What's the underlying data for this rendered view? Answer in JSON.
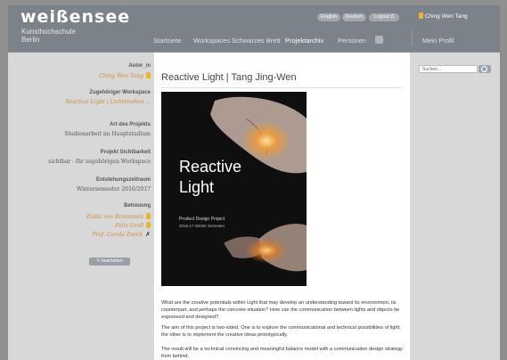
{
  "header": {
    "logo": "weißensee",
    "logo_sub1": "Kunsthochschule",
    "logo_sub2": "Berlin",
    "lang_en": "English",
    "lang_de": "Deutsch",
    "logout": "Logout",
    "user": "Ching Wen Tang"
  },
  "nav": {
    "items": [
      "Startseite",
      "Workspaces",
      "Schwarzes Brett",
      "Projektarchiv",
      "Personen"
    ],
    "my_profile": "Mein Profil"
  },
  "sidebar": {
    "author_label": "Autor_in",
    "author": "Ching Wen Tang",
    "workspace_label": "Zugehöriger Workspace",
    "workspace": "Reactive Light | Lichtmedien ...",
    "type_label": "Art des Projekts",
    "type": "Studienarbeit im Hauptstudium",
    "visibility_label": "Projekt Sichtbarkeit",
    "visibility": "sichtbar - für zugehörigen Workspace",
    "period_label": "Entstehungszeitraum",
    "period": "Wintersemester 2016/2017",
    "supervision_label": "Betreuung",
    "supervisors": [
      "Zulda von Bronomsis",
      "Felix Groll",
      "Prof. Carola Zwick"
    ],
    "edit_button": "bearbeiten"
  },
  "main": {
    "title": "Reactive Light | Tang Jing-Wen",
    "poster": {
      "title_line1": "Reactive",
      "title_line2": "Light",
      "sub1": "Product Design Project",
      "sub2": "2016-17 Winter Semester"
    },
    "paragraphs": [
      "What are the creative potentials within Light that may develop an understanding toward its environment, its counterpart, and perhaps the concrete situation? How can the communication between lights and objects be expressed and designed?",
      "The aim of this project is two-sided. One is to explore the communicational and technical possibilities of light; the other is to implement the creative ideas prototypically.",
      "The result will be a technical convincing and meaningful balance model with a communication design strategy from behind."
    ]
  },
  "right": {
    "search_placeholder": "Suchen..."
  },
  "colors": {
    "header_bg": "#7b8289",
    "accent_link": "#d18a3a",
    "sidebar_bg": "#d8d8d8"
  }
}
